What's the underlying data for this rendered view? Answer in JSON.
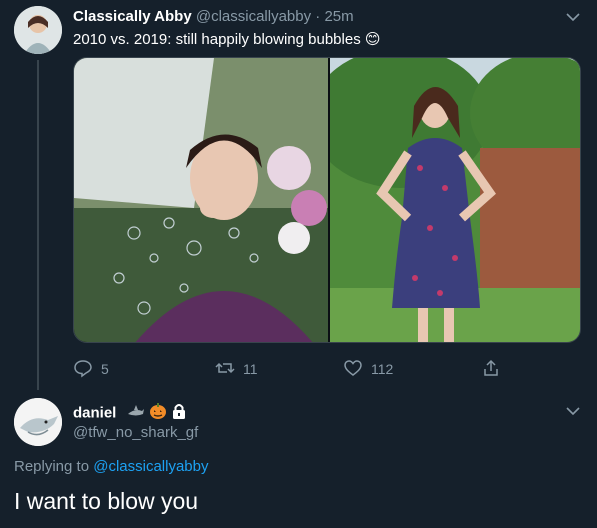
{
  "tweet": {
    "author_name": "Classically Abby",
    "author_handle": "@classicallyabby",
    "separator": "·",
    "time": "25m",
    "text": "2010 vs. 2019: still happily blowing bubbles",
    "emoji": "😊",
    "stats": {
      "replies": "5",
      "retweets": "11",
      "likes": "112"
    }
  },
  "reply": {
    "author_name": "daniel",
    "author_handle": "@tfw_no_shark_gf",
    "replying_to_prefix": "Replying to",
    "replying_to_handle": "@classicallyabby",
    "text": "I want to blow you",
    "badge_icons": [
      "shark-icon",
      "pumpkin-icon",
      "lock-icon"
    ]
  },
  "colors": {
    "background": "#15202b",
    "muted": "#8899a6",
    "link": "#1da1f2",
    "border": "#38444d"
  }
}
